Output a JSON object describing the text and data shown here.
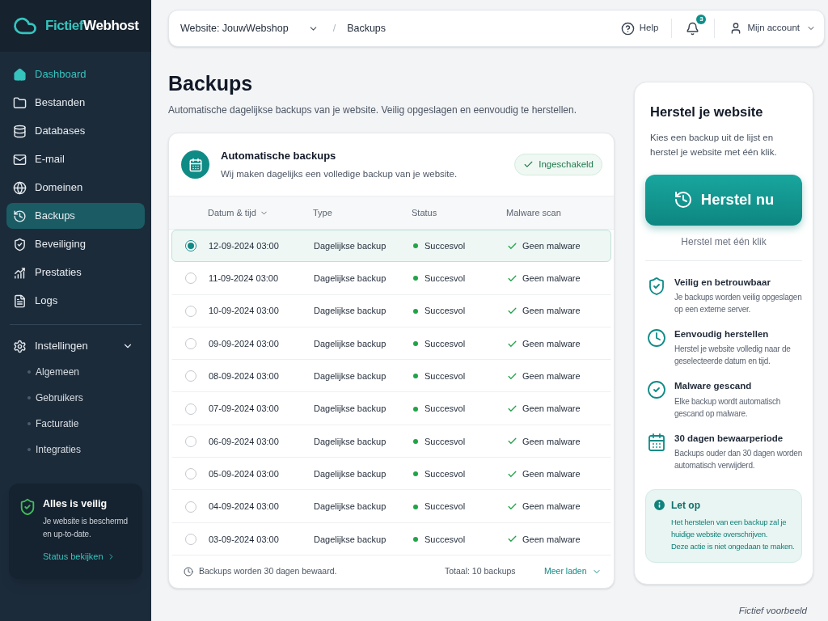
{
  "sidebar": {
    "logo": {
      "accent": "Fictief",
      "text": "Webhost"
    },
    "items": [
      {
        "label": "Dashboard",
        "highlighted": true,
        "selected": false
      },
      {
        "label": "Bestanden",
        "highlighted": false,
        "selected": false
      },
      {
        "label": "Databases",
        "highlighted": false,
        "selected": false
      },
      {
        "label": "E-mail",
        "highlighted": false,
        "selected": false
      },
      {
        "label": "Domeinen",
        "highlighted": false,
        "selected": false
      },
      {
        "label": "Backups",
        "highlighted": false,
        "selected": true
      },
      {
        "label": "Beveiliging",
        "highlighted": false,
        "selected": false
      },
      {
        "label": "Prestaties",
        "highlighted": false,
        "selected": false
      },
      {
        "label": "Logs",
        "highlighted": false,
        "selected": false
      }
    ],
    "settings": {
      "label": "Instellingen",
      "expanded": true,
      "children": [
        {
          "label": "Algemeen"
        },
        {
          "label": "Gebruikers"
        },
        {
          "label": "Facturatie"
        },
        {
          "label": "Integraties"
        }
      ]
    },
    "status_card": {
      "title": "Alles is veilig",
      "text": "Je website is beschermd en up-to-date.",
      "link": "Status bekijken"
    }
  },
  "header": {
    "website_selector": "Website: JouwWebshop",
    "separator": "/",
    "breadcrumb": "Backups",
    "help": "Help",
    "notifications": {
      "count": "3"
    },
    "account": "Mijn account"
  },
  "page": {
    "title": "Backups",
    "subtitle": "Automatische dagelijkse backups van je website. Veilig opgeslagen en eenvoudig te herstellen."
  },
  "backups_card": {
    "title": "Automatische backups",
    "description": "Wij maken dagelijks een volledige backup van je website.",
    "badge": "Ingeschakeld",
    "table": {
      "columns": [
        {
          "label": "Datum & tijd",
          "sorted": true
        },
        {
          "label": "Type",
          "sorted": false
        },
        {
          "label": "Status",
          "sorted": false
        },
        {
          "label": "Malware scan",
          "sorted": false
        }
      ],
      "rows": [
        {
          "selected": true,
          "datetime": "12-09-2024 03:00",
          "type": "Dagelijkse backup",
          "status": {
            "kind": "success",
            "label": "Succesvol"
          },
          "malware_scan": {
            "kind": "clean",
            "label": "Geen malware"
          }
        },
        {
          "selected": false,
          "datetime": "11-09-2024 03:00",
          "type": "Dagelijkse backup",
          "status": {
            "kind": "success",
            "label": "Succesvol"
          },
          "malware_scan": {
            "kind": "clean",
            "label": "Geen malware"
          }
        },
        {
          "selected": false,
          "datetime": "10-09-2024 03:00",
          "type": "Dagelijkse backup",
          "status": {
            "kind": "success",
            "label": "Succesvol"
          },
          "malware_scan": {
            "kind": "clean",
            "label": "Geen malware"
          }
        },
        {
          "selected": false,
          "datetime": "09-09-2024 03:00",
          "type": "Dagelijkse backup",
          "status": {
            "kind": "success",
            "label": "Succesvol"
          },
          "malware_scan": {
            "kind": "clean",
            "label": "Geen malware"
          }
        },
        {
          "selected": false,
          "datetime": "08-09-2024 03:00",
          "type": "Dagelijkse backup",
          "status": {
            "kind": "success",
            "label": "Succesvol"
          },
          "malware_scan": {
            "kind": "clean",
            "label": "Geen malware"
          }
        },
        {
          "selected": false,
          "datetime": "07-09-2024 03:00",
          "type": "Dagelijkse backup",
          "status": {
            "kind": "success",
            "label": "Succesvol"
          },
          "malware_scan": {
            "kind": "clean",
            "label": "Geen malware"
          }
        },
        {
          "selected": false,
          "datetime": "06-09-2024 03:00",
          "type": "Dagelijkse backup",
          "status": {
            "kind": "success",
            "label": "Succesvol"
          },
          "malware_scan": {
            "kind": "clean",
            "label": "Geen malware"
          }
        },
        {
          "selected": false,
          "datetime": "05-09-2024 03:00",
          "type": "Dagelijkse backup",
          "status": {
            "kind": "success",
            "label": "Succesvol"
          },
          "malware_scan": {
            "kind": "clean",
            "label": "Geen malware"
          }
        },
        {
          "selected": false,
          "datetime": "04-09-2024 03:00",
          "type": "Dagelijkse backup",
          "status": {
            "kind": "success",
            "label": "Succesvol"
          },
          "malware_scan": {
            "kind": "clean",
            "label": "Geen malware"
          }
        },
        {
          "selected": false,
          "datetime": "03-09-2024 03:00",
          "type": "Dagelijkse backup",
          "status": {
            "kind": "success",
            "label": "Succesvol"
          },
          "malware_scan": {
            "kind": "clean",
            "label": "Geen malware"
          }
        }
      ]
    },
    "footer": {
      "retention": "Backups worden 30 dagen bewaard.",
      "total": "Totaal: 10 backups",
      "load_more": "Meer laden"
    }
  },
  "restore_panel": {
    "title": "Herstel je website",
    "description": "Kies een backup uit de lijst en herstel je website met één klik.",
    "button": "Herstel nu",
    "button_caption": "Herstel met één klik",
    "features": [
      {
        "title": "Veilig en betrouwbaar",
        "text": "Je backups worden veilig opgeslagen op een externe server."
      },
      {
        "title": "Eenvoudig herstellen",
        "text": "Herstel je website volledig naar de geselecteerde datum en tijd."
      },
      {
        "title": "Malware gescand",
        "text": "Elke backup wordt automatisch gescand op malware."
      },
      {
        "title": "30 dagen bewaarperiode",
        "text": "Backups ouder dan 30 dagen worden automatisch verwijderd."
      }
    ],
    "notice": {
      "title": "Let op",
      "lines": [
        "Het herstelen van een backup zal je huidige website overschrijven.",
        "Deze actie is niet ongedaan te maken."
      ]
    }
  },
  "footnote": "Fictief voorbeeld"
}
